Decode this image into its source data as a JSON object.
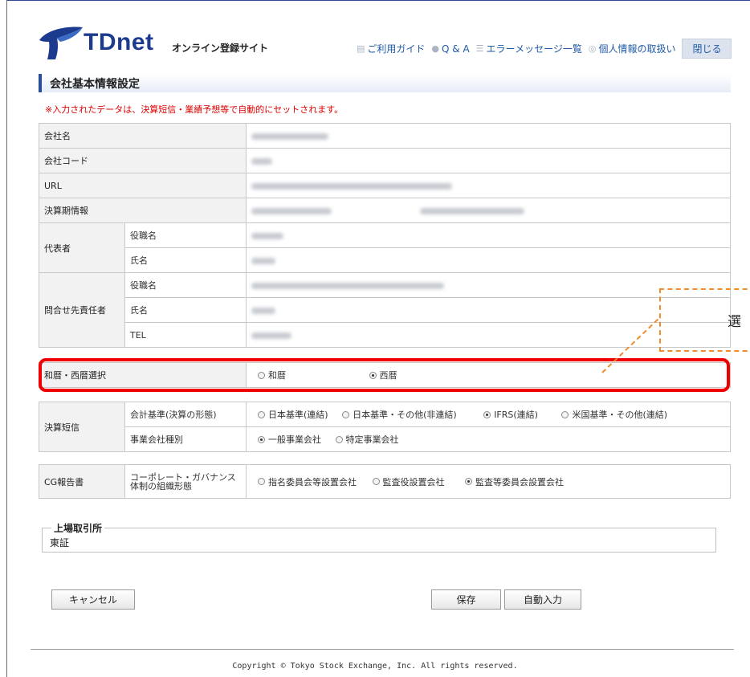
{
  "header": {
    "logo_text": "TDnet",
    "site_name": "オンライン登録サイト",
    "nav": [
      {
        "icon": "guide-icon",
        "label": "ご利用ガイド"
      },
      {
        "icon": "qa-icon",
        "label": "Q & A"
      },
      {
        "icon": "list-icon",
        "label": "エラーメッセージ一覧"
      },
      {
        "icon": "privacy-icon",
        "label": "個人情報の取扱い"
      }
    ],
    "close_label": "閉じる"
  },
  "page_title": "会社基本情報設定",
  "notice": "※入力されたデータは、決算短信・業績予想等で自動的にセットされます。",
  "info": {
    "company_name": "会社名",
    "company_code": "会社コード",
    "url": "URL",
    "fiscal_period": "決算期情報",
    "representative": "代表者",
    "title": "役職名",
    "name": "氏名",
    "contact": "問合せ先責任者",
    "tel": "TEL"
  },
  "era": {
    "label": "和暦・西暦選択",
    "options": [
      "和暦",
      "西暦"
    ],
    "selected": "西暦"
  },
  "tanshin": {
    "label": "決算短信",
    "standard_label": "会計基準(決算の形態)",
    "standard_options": [
      "日本基準(連結)",
      "日本基準・その他(非連結)",
      "IFRS(連結)",
      "米国基準・その他(連結)"
    ],
    "standard_selected": "IFRS(連結)",
    "type_label": "事業会社種別",
    "type_options": [
      "一般事業会社",
      "特定事業会社"
    ],
    "type_selected": "一般事業会社"
  },
  "cg": {
    "label": "CG報告書",
    "structure_label_1": "コーポレート・ガバナンス",
    "structure_label_2": "体制の組織形態",
    "options": [
      "指名委員会等設置会社",
      "監査役設置会社",
      "監査等委員会設置会社"
    ],
    "selected": "監査等委員会設置会社"
  },
  "exchange": {
    "legend": "上場取引所",
    "value": "東証"
  },
  "buttons": {
    "cancel": "キャンセル",
    "save": "保存",
    "auto_input": "自動入力"
  },
  "callout_text": "選",
  "footer": "Copyright © Tokyo Stock Exchange, Inc. All rights reserved.",
  "colors": {
    "brand": "#1c3a8e",
    "highlight": "#e00000",
    "callout": "#f08c2e",
    "notice": "#dd0000"
  }
}
